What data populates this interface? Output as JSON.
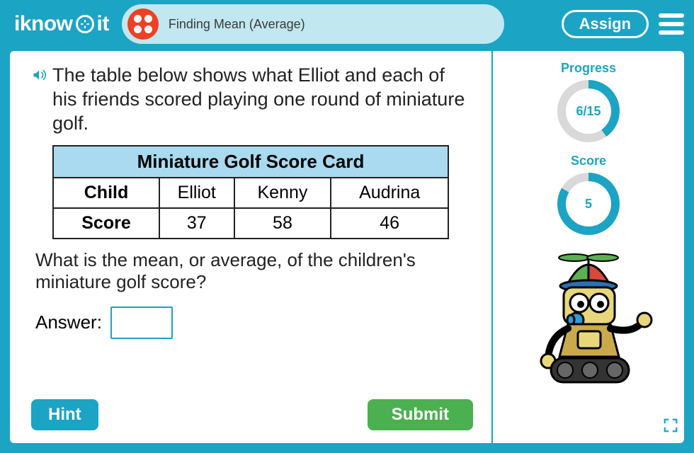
{
  "header": {
    "logo_text_a": "iknow",
    "logo_text_b": "it",
    "lesson_title": "Finding Mean (Average)",
    "assign_label": "Assign"
  },
  "question": {
    "prompt": "The table below shows what Elliot and each of his friends scored playing one round of miniature golf.",
    "table_title": "Miniature Golf Score Card",
    "row1_label": "Child",
    "row2_label": "Score",
    "c1": "Elliot",
    "c2": "Kenny",
    "c3": "Audrina",
    "s1": "37",
    "s2": "58",
    "s3": "46",
    "followup": "What is the mean, or average, of the children's miniature golf score?",
    "answer_label": "Answer:",
    "answer_value": ""
  },
  "buttons": {
    "hint": "Hint",
    "submit": "Submit"
  },
  "side": {
    "progress_label": "Progress",
    "progress_text": "6/15",
    "score_label": "Score",
    "score_text": "5"
  }
}
